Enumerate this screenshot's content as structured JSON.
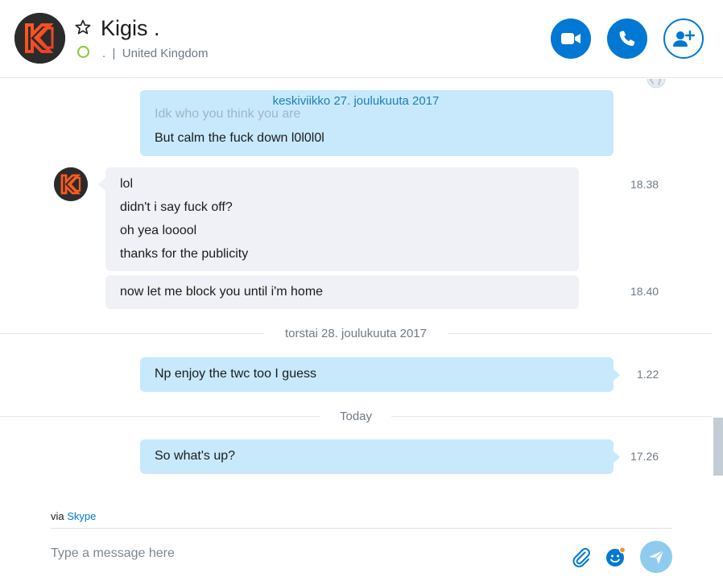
{
  "header": {
    "contact_name": "Kigis .",
    "status_dot": ".",
    "status_separator": "|",
    "location": "United Kingdom",
    "icons": {
      "avatar": "k-logo-avatar",
      "favorite": "star-outline-icon",
      "presence": "presence-ring-icon",
      "video": "video-camera-icon",
      "call": "phone-icon",
      "add_people": "add-person-icon"
    },
    "colors": {
      "accent": "#0078d4",
      "presence": "#8cc63f"
    }
  },
  "chat": {
    "sticky_date": "keskiviikko 27. joulukuuta 2017",
    "faded_lines": [
      "Idk who you think you are"
    ],
    "blocks": [
      {
        "direction": "outgoing",
        "lines": [
          "But calm the fuck down l0l0l0l"
        ],
        "time": ""
      },
      {
        "direction": "incoming",
        "lines": [
          "lol",
          "didn't i say fuck off?",
          "oh yea looool",
          "thanks for the publicity"
        ],
        "time": "18.38"
      },
      {
        "direction": "incoming",
        "lines": [
          "now let me block you until i'm home"
        ],
        "time": "18.40"
      },
      {
        "direction": "outgoing",
        "lines": [
          "Np enjoy the twc too I guess"
        ],
        "time": "1.22"
      },
      {
        "direction": "outgoing",
        "lines": [
          "So what's up?"
        ],
        "time": "17.26"
      }
    ],
    "separators": [
      "torstai 28. joulukuuta 2017",
      "Today"
    ],
    "colors": {
      "outgoing": "#c7e9fb",
      "incoming": "#eff1f6"
    }
  },
  "footer": {
    "via_prefix": "via",
    "via_link": "Skype",
    "input_placeholder": "Type a message here",
    "icons": {
      "attach": "paperclip-icon",
      "emoji": "emoticon-icon",
      "send": "send-icon"
    }
  }
}
